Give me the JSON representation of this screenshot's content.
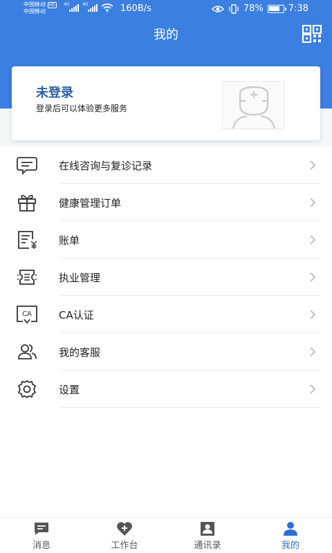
{
  "status_bar": {
    "carrier_1": "中国移动",
    "hd_badge": "HD",
    "carrier_2": "中国移动",
    "net_1": "4G",
    "net_2": "4G",
    "net_speed": "160B/s",
    "battery": "78%",
    "battery_level": 0.78,
    "time": "7:38"
  },
  "header": {
    "title": "我的",
    "qr_icon": "qr-code-icon"
  },
  "login_card": {
    "title": "未登录",
    "subtitle": "登录后可以体验更多服务",
    "avatar_icon": "doctor-avatar-icon"
  },
  "menu": {
    "items": [
      {
        "label": "在线咨询与复诊记录",
        "icon": "chat-bubble-icon"
      },
      {
        "label": "健康管理订单",
        "icon": "gift-icon"
      },
      {
        "label": "账单",
        "icon": "bill-icon"
      },
      {
        "label": "执业管理",
        "icon": "ticket-list-icon"
      },
      {
        "label": "CA认证",
        "icon": "ca-certificate-icon"
      },
      {
        "label": "我的客服",
        "icon": "users-icon"
      },
      {
        "label": "设置",
        "icon": "settings-gear-icon"
      }
    ]
  },
  "tabbar": {
    "items": [
      {
        "label": "消息",
        "icon": "message-icon"
      },
      {
        "label": "工作台",
        "icon": "heart-plus-icon"
      },
      {
        "label": "通讯录",
        "icon": "contacts-icon"
      },
      {
        "label": "我的",
        "icon": "person-icon"
      }
    ],
    "active_color": "#2e6cd6",
    "inactive_color": "#555555"
  },
  "colors": {
    "header_blue": "#3b7fe0",
    "login_title": "#2a5fa8"
  }
}
